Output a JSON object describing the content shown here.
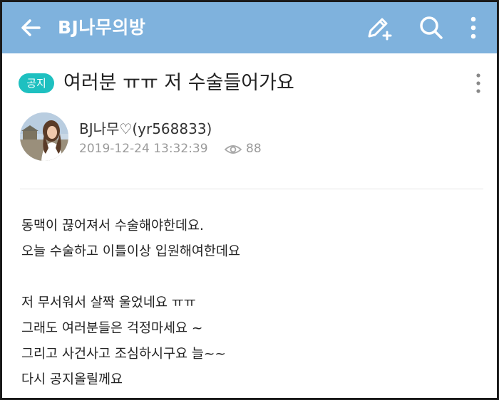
{
  "appbar": {
    "title": "BJ나무의방",
    "icons": [
      "back-arrow-icon",
      "write-icon",
      "search-icon",
      "more-vertical-icon"
    ],
    "color": "#7fb2dd"
  },
  "post": {
    "badge": "공지",
    "badge_color": "#1ec0c0",
    "title": "여러분 ㅠㅠ 저 수술들어가요",
    "author": "BJ나무♡(yr568833)",
    "datetime": "2019-12-24 13:32:39",
    "views": "88",
    "paragraphs": [
      [
        "동맥이 끊어져서 수술해야한데요.",
        "오늘 수술하고 이틀이상 입원해여한데요"
      ],
      [
        "저 무서워서 살짝 울었네요 ㅠㅠ",
        "그래도 여러분들은 걱정마세요 ~",
        "그리고 사건사고 조심하시구요 늘~~",
        "다시 공지올릴께요"
      ]
    ]
  }
}
